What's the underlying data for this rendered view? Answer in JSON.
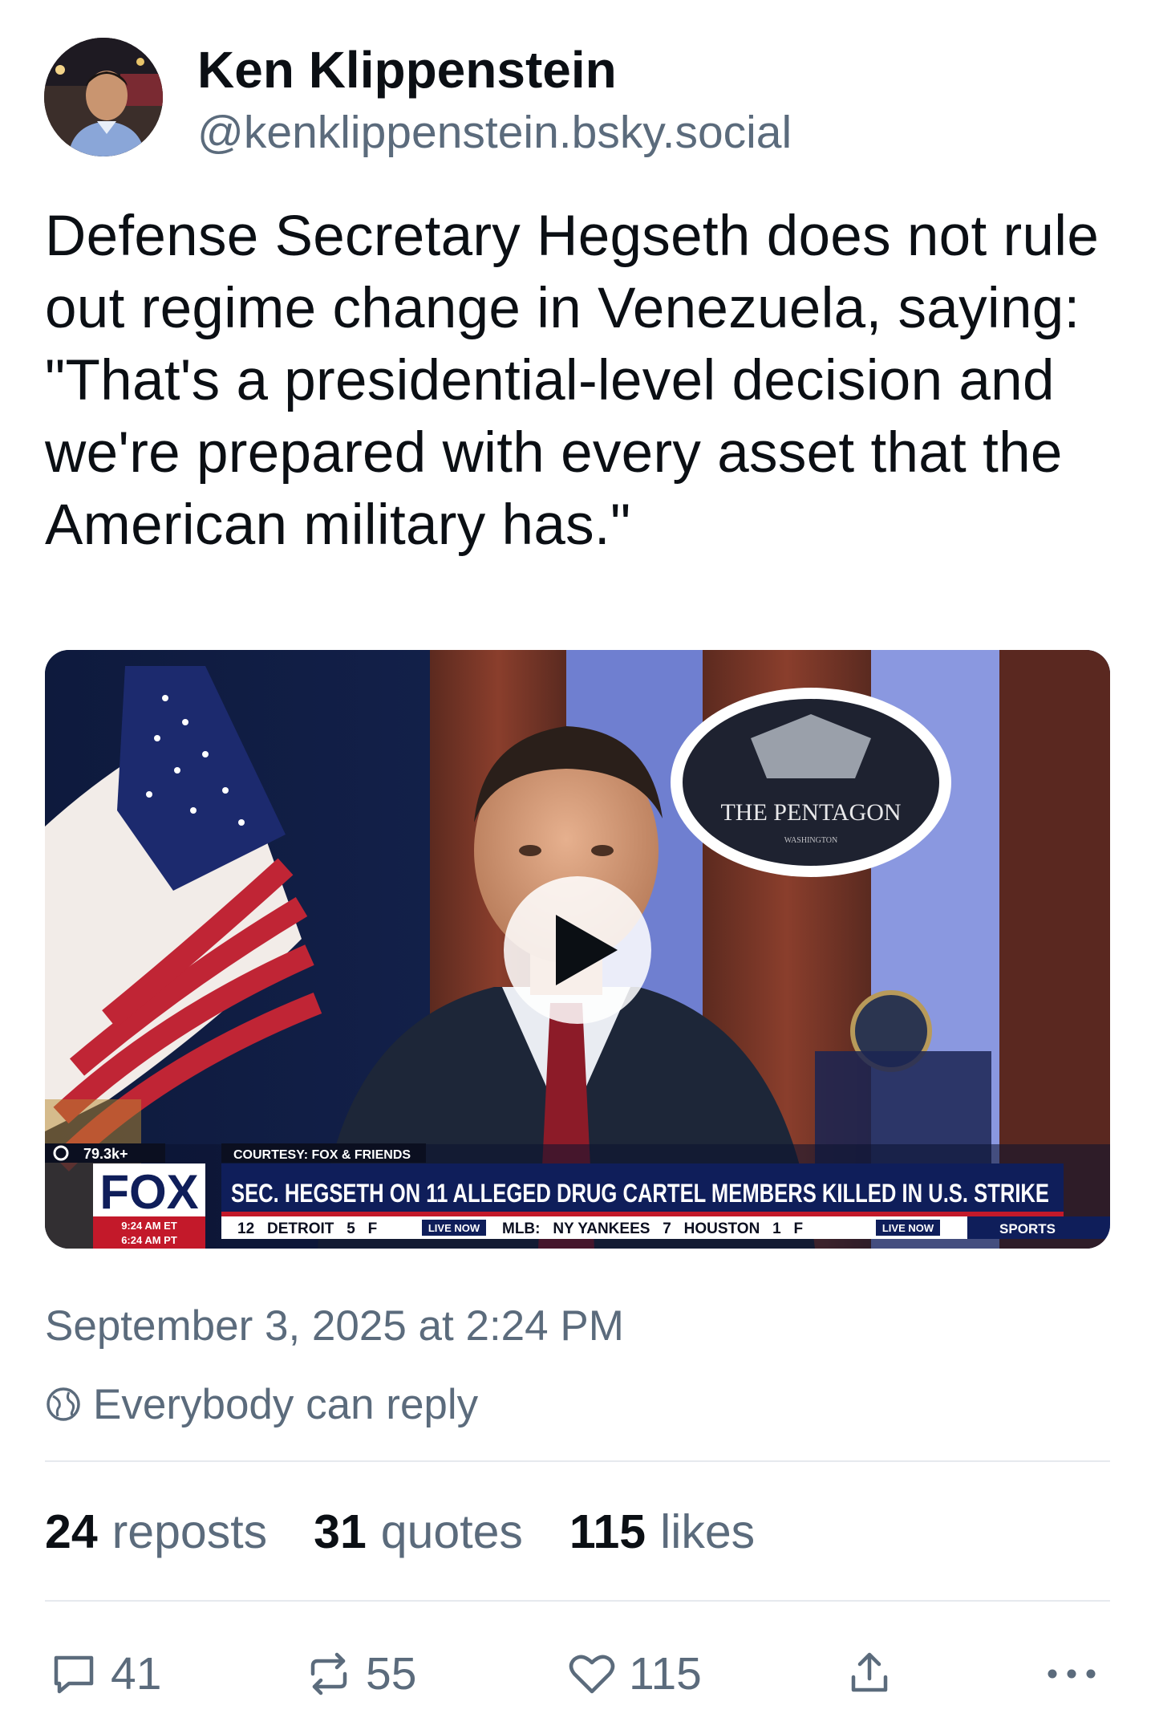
{
  "author": {
    "display_name": "Ken Klippenstein",
    "handle": "@kenklippenstein.bsky.social"
  },
  "post": {
    "text": "Defense Secretary Hegseth does not rule out regime change in Venezuela, saying: \"That's a presidential-level decision and we're prepared with every asset that the American military has.\"",
    "timestamp": "September 3, 2025 at 2:24 PM",
    "reply_setting": "Everybody can reply"
  },
  "video": {
    "seal_text": "THE PENTAGON",
    "seal_subtext": "WASHINGTON",
    "viewers": "79.3k+",
    "network": "FOX",
    "courtesy": "COURTESY: FOX & FRIENDS",
    "headline": "SEC. HEGSETH ON 11 ALLEGED DRUG CARTEL MEMBERS KILLED IN U.S. STRIKE",
    "time_et": "9:24 AM ET",
    "time_pt": "6:24 AM PT",
    "ticker": "12   DETROIT   5   F",
    "ticker_live": "LIVE NOW",
    "ticker_2": "MLB:   NY YANKEES   7   HOUSTON   1   F",
    "ticker_sports": "SPORTS"
  },
  "stats": {
    "reposts_count": "24",
    "reposts_label": "reposts",
    "quotes_count": "31",
    "quotes_label": "quotes",
    "likes_count": "115",
    "likes_label": "likes"
  },
  "actions": {
    "reply_count": "41",
    "repost_count": "55",
    "like_count": "115"
  },
  "colors": {
    "text_primary": "#0b0f14",
    "text_secondary": "#5b6b7c",
    "divider": "#e6e9ee",
    "fox_blue": "#0f1e5a",
    "chyron_red": "#c3192a"
  },
  "icons": [
    "reply-icon",
    "repost-icon",
    "like-icon",
    "share-icon",
    "more-icon",
    "globe-icon",
    "play-icon",
    "eye-icon"
  ]
}
